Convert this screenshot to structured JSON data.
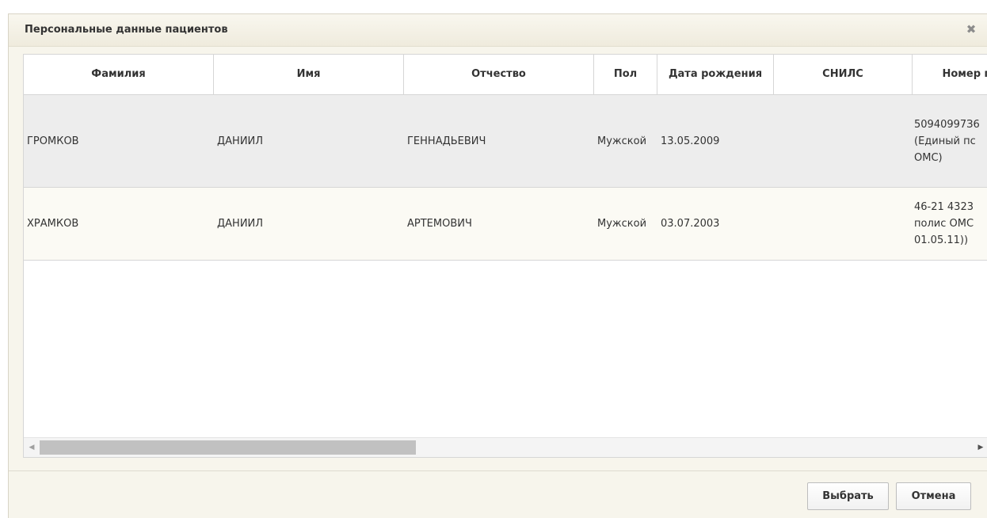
{
  "dialog": {
    "title": "Персональные данные пациентов",
    "close_icon": "✖"
  },
  "grid": {
    "columns": [
      "Фамилия",
      "Имя",
      "Отчество",
      "Пол",
      "Дата рождения",
      "СНИЛС",
      "Номер п"
    ],
    "rows": [
      {
        "last_name": "ГРОМКОВ",
        "first_name": "ДАНИИЛ",
        "patronymic": "ГЕННАДЬЕВИЧ",
        "sex": "Мужской",
        "birth_date": "13.05.2009",
        "snils": "",
        "policy_lines": [
          "50940997З6",
          "(Единый пс",
          "ОМС)"
        ]
      },
      {
        "last_name": "ХРАМКОВ",
        "first_name": "ДАНИИЛ",
        "patronymic": "АРТЕМОВИЧ",
        "sex": "Мужской",
        "birth_date": "03.07.2003",
        "snils": "",
        "policy_lines": [
          "46-21 4323",
          "полис ОМС",
          "01.05.11))"
        ]
      }
    ],
    "scroll_position": 0.0
  },
  "footer": {
    "select_label": "Выбрать",
    "cancel_label": "Отмена"
  }
}
